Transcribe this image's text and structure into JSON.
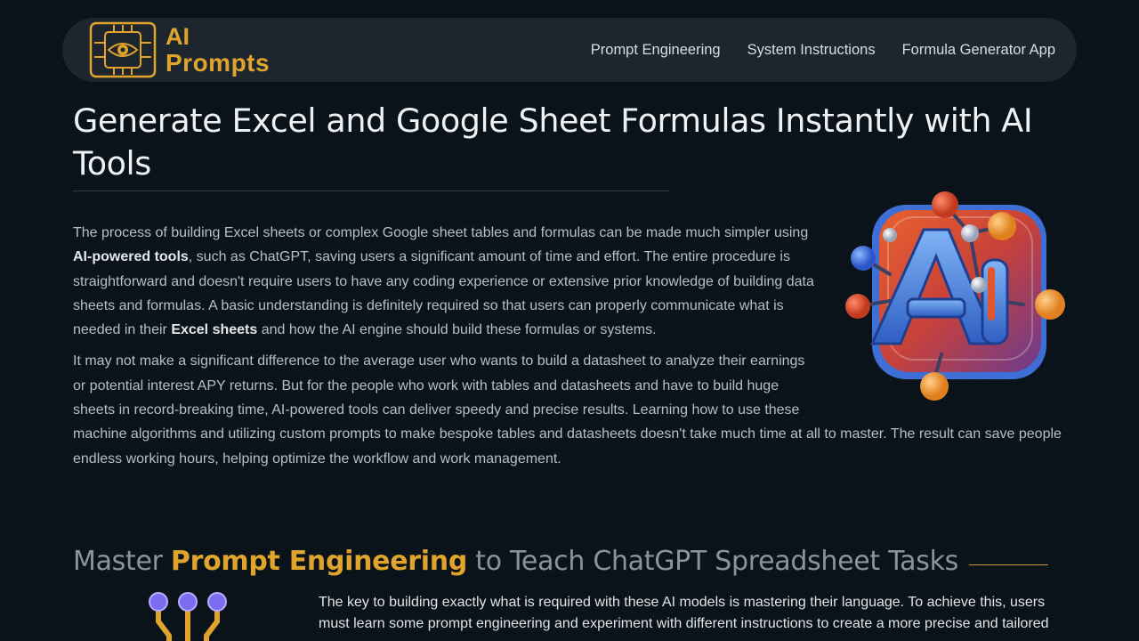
{
  "logo": {
    "line1": "AI",
    "line2": "Prompts"
  },
  "nav": [
    {
      "label": "Prompt Engineering"
    },
    {
      "label": "System Instructions"
    },
    {
      "label": "Formula Generator App"
    }
  ],
  "page_title": "Generate Excel and Google Sheet Formulas Instantly with AI Tools",
  "intro": {
    "p1_a": "The process of building Excel sheets or complex Google sheet tables and formulas can be made much simpler using ",
    "p1_b": "AI-powered tools",
    "p1_c": ", such as ChatGPT, saving users a significant amount of time and effort. The entire procedure is straightforward and doesn't require users to have any coding experience or extensive prior knowledge of building data sheets and formulas. A basic understanding is definitely required so that users can properly communicate what is needed in their ",
    "p1_d": "Excel sheets",
    "p1_e": " and how the AI engine should build these formulas or systems.",
    "p2": "It may not make a significant difference to the average user who wants to build a datasheet to analyze their earnings or potential interest APY returns. But for the people who work with tables and datasheets and have to build huge sheets in record-breaking time, AI-powered tools can deliver speedy and precise results. Learning how to use these machine algorithms and utilizing custom prompts to make bespoke tables and datasheets doesn't take much time at all to master. The result can save people endless working hours, helping optimize the workflow and work management."
  },
  "section2": {
    "heading_a": "Master ",
    "heading_b": "Prompt Engineering",
    "heading_c": " to Teach ChatGPT Spreadsheet Tasks",
    "text": "The key to building exactly what is required with these AI models is mastering their language. To achieve this, users must learn some prompt engineering and experiment with different instructions to create a more precise and tailored"
  },
  "colors": {
    "accent": "#e0a42c",
    "background": "#0b131a",
    "navbar": "#1d262e"
  },
  "icons": {
    "logo": "circuit-eye-icon",
    "hero": "ai-molecule-illustration",
    "section": "circuit-nodes-icon"
  }
}
